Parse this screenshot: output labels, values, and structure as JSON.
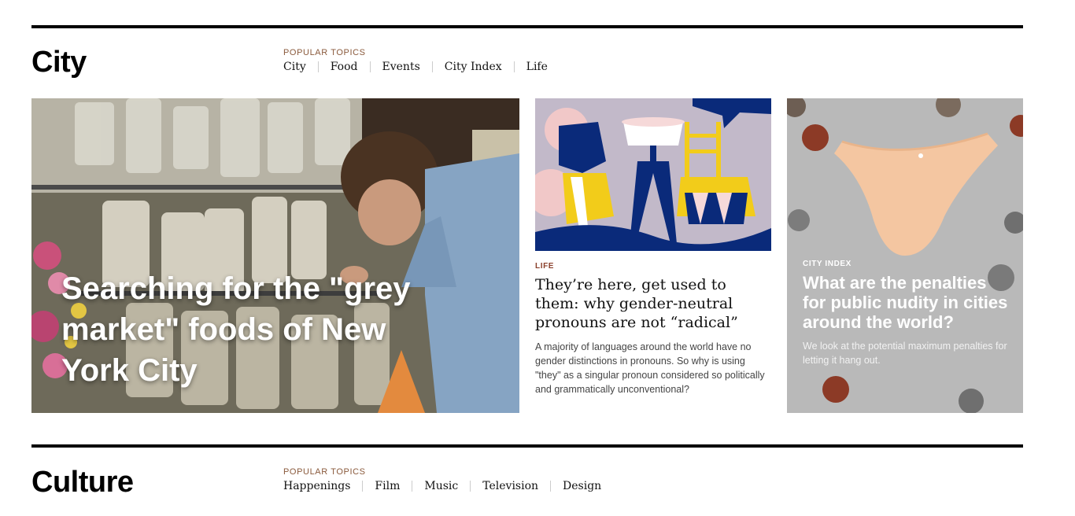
{
  "sections": {
    "city": {
      "title": "City",
      "popular_label": "POPULAR TOPICS",
      "topics": [
        "City",
        "Food",
        "Events",
        "City Index",
        "Life"
      ]
    },
    "culture": {
      "title": "Culture",
      "popular_label": "POPULAR TOPICS",
      "topics": [
        "Happenings",
        "Film",
        "Music",
        "Television",
        "Design"
      ]
    }
  },
  "cards": {
    "main": {
      "headline": "Searching for the \"grey market\" foods of New York City",
      "image": "man-browsing-jars-photo"
    },
    "mid": {
      "kicker": "LIFE",
      "headline": "They’re here, get used to them: why gender-neutral pronouns are not “radical”",
      "dek": "A majority of languages around the world have no gender distinctions in pronouns. So why is using \"they\" as a singular pronoun considered so politically and grammatically unconventional?",
      "image": "chairs-illustration"
    },
    "right": {
      "kicker": "CITY INDEX",
      "headline": "What are the penalties for public nudity in cities around the world?",
      "dek": "We look at the potential maximum penalties for letting it hang out.",
      "image": "underwear-and-coins-photo"
    }
  },
  "colors": {
    "rule": "#000000",
    "kicker": "#8a3f2a",
    "right_bg": "#b9b9b9"
  }
}
